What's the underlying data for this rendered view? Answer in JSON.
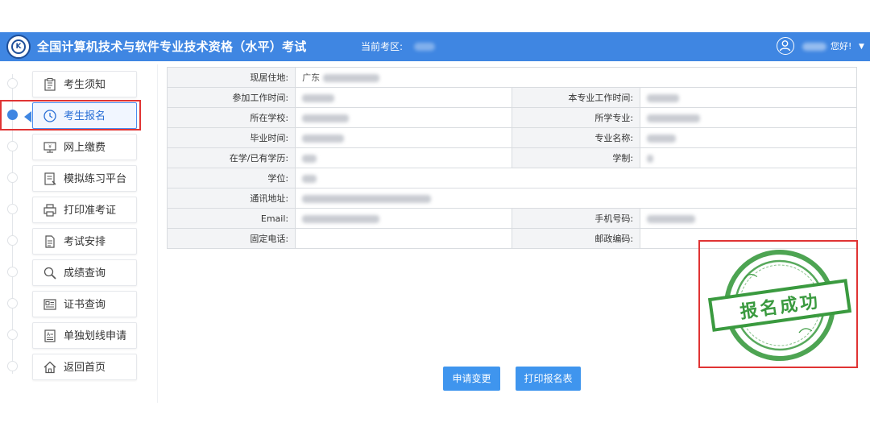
{
  "header": {
    "title": "全国计算机技术与软件专业技术资格（水平）考试",
    "area_label": "当前考区:",
    "greeting": "您好!",
    "icons": {
      "logo": "exam-logo",
      "user": "user-circle-icon",
      "dropdown": "chevron-down-icon"
    },
    "colors": {
      "header_bg": "#3f86e2",
      "accent": "#3f86e2",
      "highlight_border": "#e03434"
    }
  },
  "sidebar": {
    "items": [
      {
        "label": "考生须知",
        "icon": "notice-icon",
        "active": false
      },
      {
        "label": "考生报名",
        "icon": "clock-icon",
        "active": true
      },
      {
        "label": "网上缴费",
        "icon": "monitor-icon",
        "active": false
      },
      {
        "label": "模拟练习平台",
        "icon": "practice-icon",
        "active": false
      },
      {
        "label": "打印准考证",
        "icon": "printer-icon",
        "active": false
      },
      {
        "label": "考试安排",
        "icon": "document-icon",
        "active": false
      },
      {
        "label": "成绩查询",
        "icon": "search-icon",
        "active": false
      },
      {
        "label": "证书查询",
        "icon": "certificate-icon",
        "active": false
      },
      {
        "label": "单独划线申请",
        "icon": "form-icon",
        "active": false
      },
      {
        "label": "返回首页",
        "icon": "home-icon",
        "active": false
      }
    ]
  },
  "info": {
    "residence_label": "现居住地:",
    "residence_value": "广东",
    "work_start_label": "参加工作时间:",
    "major_work_start_label": "本专业工作时间:",
    "school_label": "所在学校:",
    "major_label": "所学专业:",
    "graduation_label": "毕业时间:",
    "major_name_label": "专业名称:",
    "education_label": "在学/已有学历:",
    "study_length_label": "学制:",
    "degree_label": "学位:",
    "address_label": "通讯地址:",
    "email_label": "Email:",
    "phone_label": "手机号码:",
    "landline_label": "固定电话:",
    "postcode_label": "邮政编码:"
  },
  "stamp": {
    "text": "报名成功",
    "color": "#3a9a3f"
  },
  "buttons": {
    "change_label": "申请变更",
    "print_label": "打印报名表"
  }
}
